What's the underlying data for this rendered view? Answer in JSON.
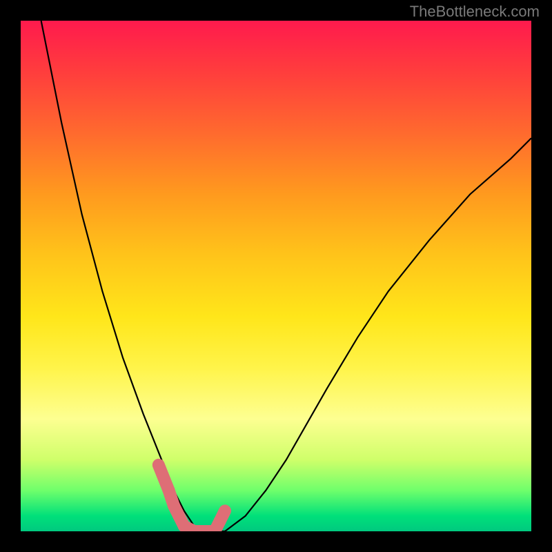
{
  "watermark": "TheBottleneck.com",
  "chart_data": {
    "type": "line",
    "title": "",
    "xlabel": "",
    "ylabel": "",
    "xlim": [
      0,
      100
    ],
    "ylim": [
      0,
      100
    ],
    "series": [
      {
        "name": "curve",
        "x": [
          4,
          8,
          12,
          16,
          20,
          24,
          28,
          30,
          32,
          34,
          36,
          40,
          44,
          48,
          52,
          56,
          60,
          66,
          72,
          80,
          88,
          96,
          100
        ],
        "y": [
          100,
          80,
          62,
          47,
          34,
          23,
          13,
          8,
          4,
          1,
          0,
          0,
          3,
          8,
          14,
          21,
          28,
          38,
          47,
          57,
          66,
          73,
          77
        ]
      },
      {
        "name": "highlight",
        "x": [
          27,
          29,
          30,
          31,
          32,
          34,
          36,
          38,
          39,
          40
        ],
        "y": [
          13,
          8,
          5,
          3,
          1,
          0,
          0,
          0,
          2,
          4
        ]
      }
    ],
    "highlight_color": "#de6e76",
    "curve_color": "#000000"
  }
}
